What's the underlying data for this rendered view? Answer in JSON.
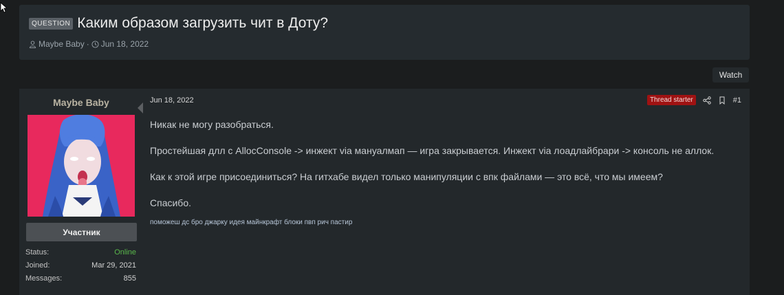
{
  "thread": {
    "label": "QUESTION",
    "title": "Каким образом загрузить чит в Доту?",
    "author": "Maybe Baby",
    "separator": "·",
    "date": "Jun 18, 2022"
  },
  "watch_label": "Watch",
  "post": {
    "username": "Maybe Baby",
    "user_title": "Участник",
    "stats": [
      {
        "label": "Status:",
        "value": "Online"
      },
      {
        "label": "Joined:",
        "value": "Mar 29, 2021"
      },
      {
        "label": "Messages:",
        "value": "855"
      }
    ],
    "date": "Jun 18, 2022",
    "starter_badge": "Thread starter",
    "number": "#1",
    "paragraphs": [
      "Никак не могу разобраться.",
      "Простейшая длл с AllocConsole -> инжект via мануалмап — игра закрывается. Инжект via лоадлайбрари -> консоль не аллок.",
      "Как к этой игре присоединиться? На гитхабе видел только манипуляции с впк файлами — это всё, что мы имеем?",
      "Спасибо."
    ],
    "signature": "поможеш дс бро джарку идея майнкрафт блоки пвп рич пастир"
  },
  "icons": {
    "author": "user-icon",
    "date": "clock-icon",
    "share": "share-icon",
    "bookmark": "bookmark-icon"
  },
  "colors": {
    "background": "#1b1d1e",
    "panel": "#252b2f",
    "starter_badge": "#9f1212",
    "online": "#5ab84b"
  }
}
